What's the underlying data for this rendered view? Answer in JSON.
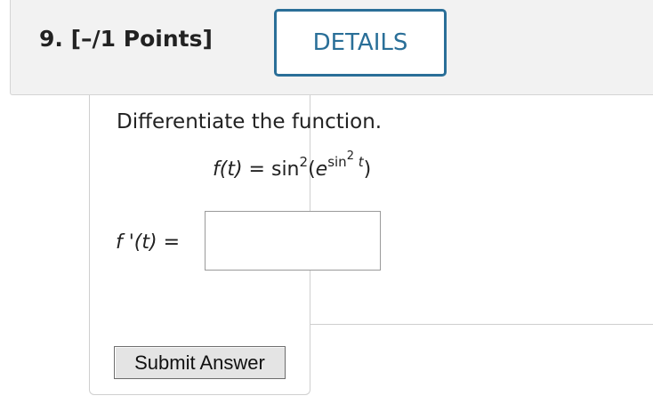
{
  "question": {
    "number_label": "9.",
    "points_label": "[–/1 Points]",
    "details_label": "DETAILS"
  },
  "problem": {
    "instruction": "Differentiate the function.",
    "function": {
      "lhs": "f(t)",
      "equals": "=",
      "sin_word": "sin",
      "power": "2",
      "open": "(",
      "base": "e",
      "exp_sin": "sin",
      "exp_power": "2",
      "exp_var": "t",
      "close": ")"
    },
    "derivative_label": "f '(t)",
    "derivative_equals": "=",
    "answer_value": ""
  },
  "actions": {
    "submit_label": "Submit Answer"
  }
}
